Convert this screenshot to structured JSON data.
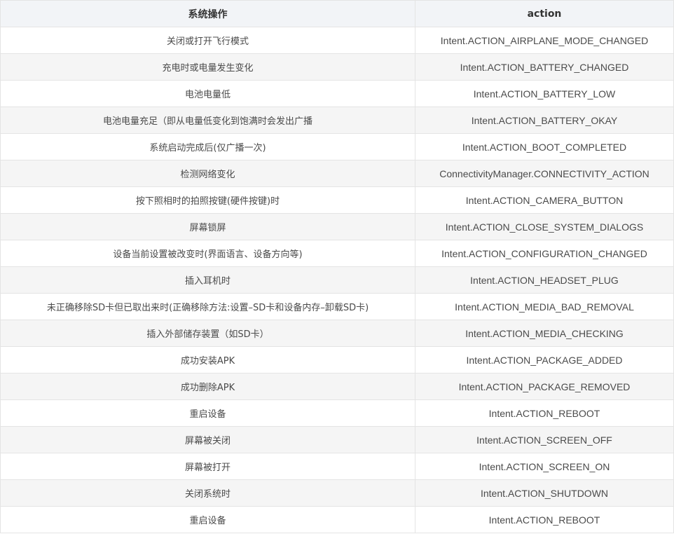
{
  "table": {
    "headers": [
      "系统操作",
      "action"
    ],
    "rows": [
      {
        "op": "关闭或打开飞行模式",
        "action": "Intent.ACTION_AIRPLANE_MODE_CHANGED"
      },
      {
        "op": "充电时或电量发生变化",
        "action": "Intent.ACTION_BATTERY_CHANGED"
      },
      {
        "op": "电池电量低",
        "action": "Intent.ACTION_BATTERY_LOW"
      },
      {
        "op": "电池电量充足（即从电量低变化到饱满时会发出广播",
        "action": "Intent.ACTION_BATTERY_OKAY"
      },
      {
        "op": "系统启动完成后(仅广播一次)",
        "action": "Intent.ACTION_BOOT_COMPLETED"
      },
      {
        "op": "检测网络变化",
        "action": "ConnectivityManager.CONNECTIVITY_ACTION"
      },
      {
        "op": "按下照相时的拍照按键(硬件按键)时",
        "action": "Intent.ACTION_CAMERA_BUTTON"
      },
      {
        "op": "屏幕锁屏",
        "action": "Intent.ACTION_CLOSE_SYSTEM_DIALOGS"
      },
      {
        "op": "设备当前设置被改变时(界面语言、设备方向等)",
        "action": "Intent.ACTION_CONFIGURATION_CHANGED"
      },
      {
        "op": "插入耳机时",
        "action": "Intent.ACTION_HEADSET_PLUG"
      },
      {
        "op": "未正确移除SD卡但已取出来时(正确移除方法:设置–SD卡和设备内存–卸载SD卡)",
        "action": "Intent.ACTION_MEDIA_BAD_REMOVAL"
      },
      {
        "op": "插入外部储存装置（如SD卡）",
        "action": "Intent.ACTION_MEDIA_CHECKING"
      },
      {
        "op": "成功安装APK",
        "action": "Intent.ACTION_PACKAGE_ADDED"
      },
      {
        "op": "成功删除APK",
        "action": "Intent.ACTION_PACKAGE_REMOVED"
      },
      {
        "op": "重启设备",
        "action": "Intent.ACTION_REBOOT"
      },
      {
        "op": "屏幕被关闭",
        "action": "Intent.ACTION_SCREEN_OFF"
      },
      {
        "op": "屏幕被打开",
        "action": "Intent.ACTION_SCREEN_ON"
      },
      {
        "op": "关闭系统时",
        "action": "Intent.ACTION_SHUTDOWN"
      },
      {
        "op": "重启设备",
        "action": "Intent.ACTION_REBOOT"
      }
    ]
  }
}
